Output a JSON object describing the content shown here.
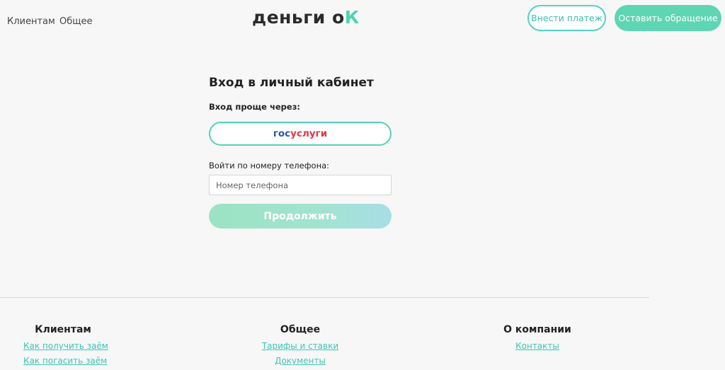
{
  "header": {
    "nav": [
      "Клиентам",
      "Общее"
    ],
    "logo_word": "деньги",
    "logo_o": "о",
    "logo_k": "К",
    "pay_button": "Внести платеж",
    "appeal_button": "Оставить обращение"
  },
  "login": {
    "title": "Вход в личный кабинет",
    "easier_via": "Вход проще через:",
    "gosuslugi_part1": "гос",
    "gosuslugi_part2": "услуги",
    "phone_label": "Войти по номеру телефона:",
    "phone_placeholder": "Номер телефона",
    "continue_button": "Продолжить"
  },
  "footer": {
    "columns": [
      {
        "title": "Клиентам",
        "links": [
          "Как получить заём",
          "Как погасить заём"
        ]
      },
      {
        "title": "Общее",
        "links": [
          "Тарифы и ставки",
          "Документы"
        ]
      },
      {
        "title": "О компании",
        "links": [
          "Контакты"
        ]
      }
    ]
  },
  "colors": {
    "accent": "#5fd6b3",
    "outline": "#55d1c2",
    "link": "#3ec4b4",
    "gos_blue": "#2a55a8",
    "gos_red": "#e0354a"
  }
}
